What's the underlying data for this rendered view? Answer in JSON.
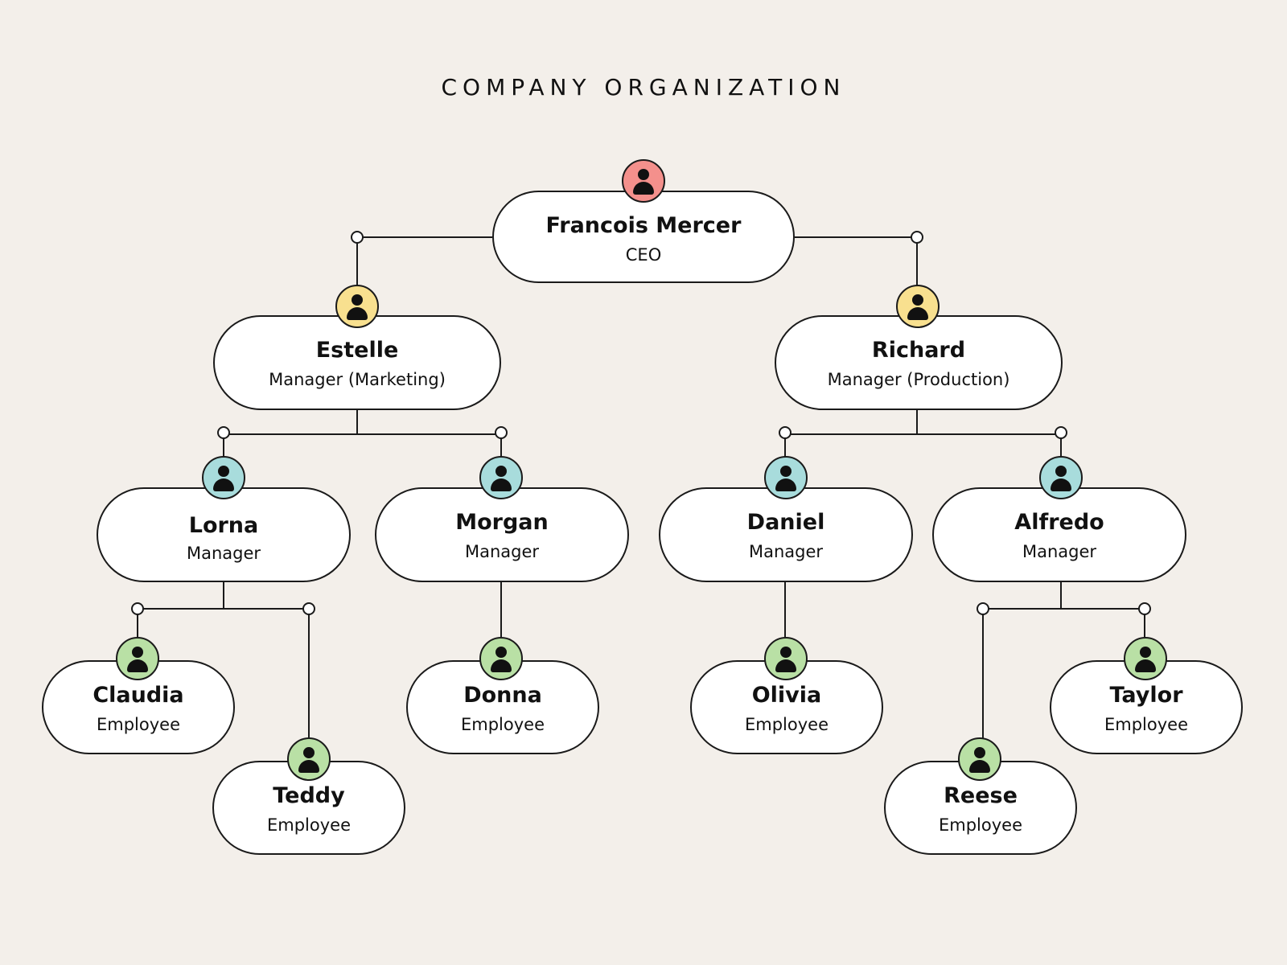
{
  "title": "COMPANY ORGANIZATION",
  "colors": {
    "background": "#f3efea",
    "ceo": "#f4908c",
    "department_manager": "#f8e08f",
    "manager": "#a8dcdc",
    "employee": "#b9e0a5"
  },
  "nodes": [
    {
      "id": "francois",
      "name": "Francois Mercer",
      "role": "CEO",
      "level": "ceo",
      "parent": null
    },
    {
      "id": "estelle",
      "name": "Estelle",
      "role": "Manager (Marketing)",
      "level": "department_manager",
      "parent": "francois"
    },
    {
      "id": "richard",
      "name": "Richard",
      "role": "Manager (Production)",
      "level": "department_manager",
      "parent": "francois"
    },
    {
      "id": "lorna",
      "name": "Lorna",
      "role": "Manager",
      "level": "manager",
      "parent": "estelle"
    },
    {
      "id": "morgan",
      "name": "Morgan",
      "role": "Manager",
      "level": "manager",
      "parent": "estelle"
    },
    {
      "id": "daniel",
      "name": "Daniel",
      "role": "Manager",
      "level": "manager",
      "parent": "richard"
    },
    {
      "id": "alfredo",
      "name": "Alfredo",
      "role": "Manager",
      "level": "manager",
      "parent": "richard"
    },
    {
      "id": "claudia",
      "name": "Claudia",
      "role": "Employee",
      "level": "employee",
      "parent": "lorna"
    },
    {
      "id": "teddy",
      "name": "Teddy",
      "role": "Employee",
      "level": "employee",
      "parent": "lorna"
    },
    {
      "id": "donna",
      "name": "Donna",
      "role": "Employee",
      "level": "employee",
      "parent": "morgan"
    },
    {
      "id": "olivia",
      "name": "Olivia",
      "role": "Employee",
      "level": "employee",
      "parent": "daniel"
    },
    {
      "id": "reese",
      "name": "Reese",
      "role": "Employee",
      "level": "employee",
      "parent": "alfredo"
    },
    {
      "id": "taylor",
      "name": "Taylor",
      "role": "Employee",
      "level": "employee",
      "parent": "alfredo"
    }
  ],
  "avatar_icon": "person-icon"
}
